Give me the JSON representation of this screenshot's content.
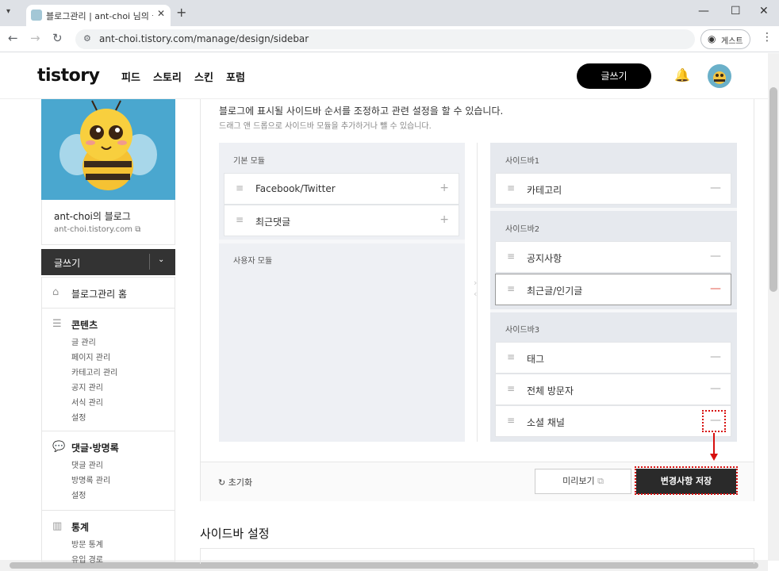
{
  "browser": {
    "tab_title": "블로그관리 | ant-choi 님의 블로그",
    "url": "ant-choi.tistory.com/manage/design/sidebar",
    "guest_label": "게스트"
  },
  "header": {
    "logo": "tistory",
    "nav": [
      "피드",
      "스토리",
      "스킨",
      "포럼"
    ],
    "write_label": "글쓰기"
  },
  "sidebar": {
    "blog_name": "ant-choi의 블로그",
    "blog_url": "ant-choi.tistory.com",
    "write_label": "글쓰기",
    "home_label": "블로그관리 홈",
    "sections": [
      {
        "title": "콘텐츠",
        "items": [
          "글 관리",
          "페이지 관리",
          "카테고리 관리",
          "공지 관리",
          "서식 관리",
          "설정"
        ]
      },
      {
        "title": "댓글·방명록",
        "items": [
          "댓글 관리",
          "방명록 관리",
          "설정"
        ]
      },
      {
        "title": "통계",
        "items": [
          "방문 통계",
          "유입 경로"
        ]
      }
    ]
  },
  "main": {
    "desc_main": "블로그에 표시될 사이드바 순서를 조정하고 관련 설정을 할 수 있습니다.",
    "desc_sub": "드래그 앤 드롭으로 사이드바 모듈을 추가하거나 뺄 수 있습니다.",
    "basic_modules_label": "기본 모듈",
    "basic_modules": [
      "Facebook/Twitter",
      "최근댓글"
    ],
    "user_modules_label": "사용자 모듈",
    "sidebars": [
      {
        "label": "사이드바1",
        "modules": [
          "카테고리"
        ]
      },
      {
        "label": "사이드바2",
        "modules": [
          "공지사항",
          "최근글/인기글"
        ]
      },
      {
        "label": "사이드바3",
        "modules": [
          "태그",
          "전체 방문자",
          "소셜 채널"
        ]
      }
    ],
    "reset_label": "초기화",
    "preview_label": "미리보기",
    "save_label": "변경사항 저장",
    "sidebar_settings_title": "사이드바 설정"
  },
  "colors": {
    "highlight": "#d7100f",
    "primary_button": "#2a2a2a",
    "remove_active": "#e35a4e"
  }
}
